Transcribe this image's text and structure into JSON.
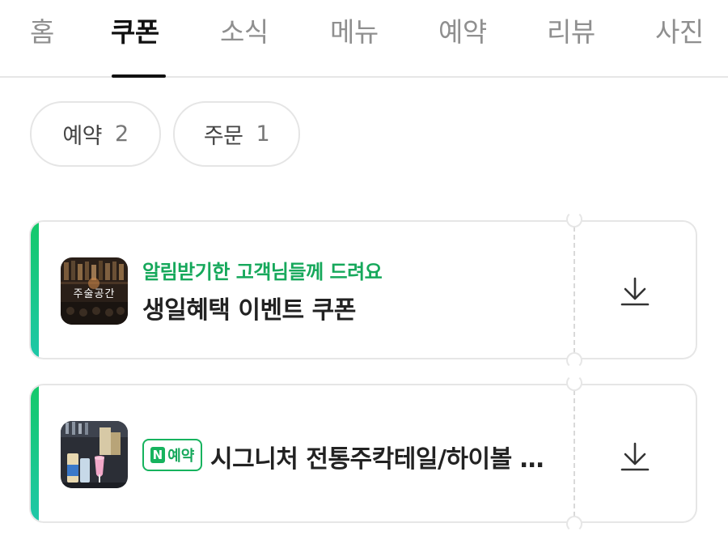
{
  "tabs": [
    {
      "label": "홈",
      "active": false
    },
    {
      "label": "쿠폰",
      "active": true
    },
    {
      "label": "소식",
      "active": false
    },
    {
      "label": "메뉴",
      "active": false
    },
    {
      "label": "예약",
      "active": false
    },
    {
      "label": "리뷰",
      "active": false
    },
    {
      "label": "사진",
      "active": false
    }
  ],
  "filters": [
    {
      "label": "예약",
      "count": "2"
    },
    {
      "label": "주문",
      "count": "1"
    }
  ],
  "coupons": [
    {
      "subtitle": "알림받기한 고객님들께 드려요",
      "title": "생일혜택 이벤트 쿠폰",
      "thumb_text": "주술공간",
      "icon": "download-icon"
    },
    {
      "badge": "예약",
      "badge_logo": "N",
      "title": "시그니처 전통주칵테일/하이볼 …",
      "icon": "download-icon"
    }
  ],
  "colors": {
    "accent_green": "#16a85b",
    "active_tab": "#111111",
    "inactive_tab": "#8f8f8f"
  }
}
